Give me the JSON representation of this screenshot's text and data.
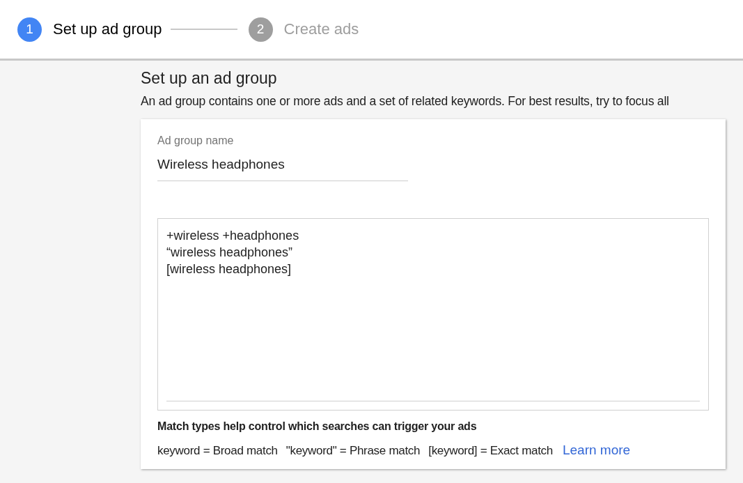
{
  "steps": [
    {
      "number": "1",
      "label": "Set up ad group",
      "selected": true
    },
    {
      "number": "2",
      "label": "Create ads",
      "selected": false
    }
  ],
  "heading": "Set up an ad group",
  "description": "An ad group contains one or more ads and a set of related keywords. For best results, try to focus all",
  "ad_group_name": {
    "label": "Ad group name",
    "value": "Wireless headphones"
  },
  "keywords": [
    "+wireless +headphones",
    "“wireless headphones”",
    "[wireless headphones]"
  ],
  "match_types": {
    "title": "Match types help control which searches can trigger your ads",
    "examples": [
      "keyword = Broad match",
      "\"keyword\" = Phrase match",
      "[keyword] = Exact match"
    ],
    "link": "Learn more"
  }
}
